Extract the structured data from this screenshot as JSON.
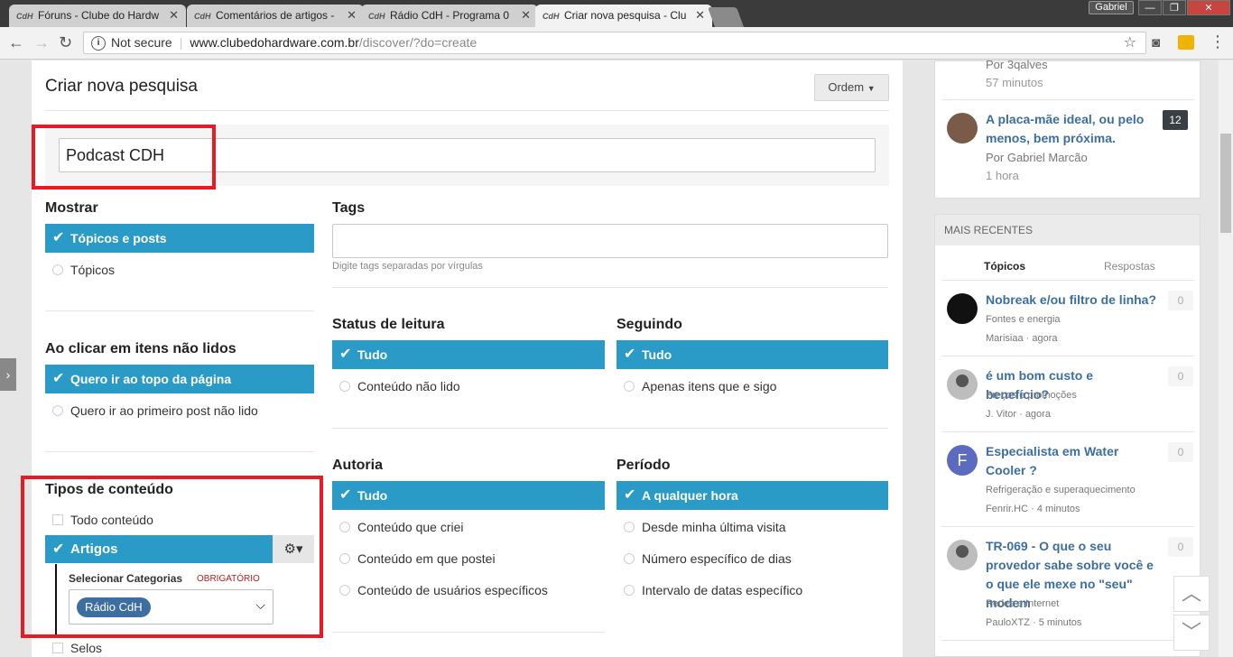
{
  "browser": {
    "tabs": [
      {
        "label": "Fóruns - Clube do Hardw",
        "icon": "cdh-favicon"
      },
      {
        "label": "Comentários de artigos -",
        "icon": "cdh-favicon"
      },
      {
        "label": "Rádio CdH - Programa 0",
        "icon": "cdh-favicon"
      },
      {
        "label": "Criar nova pesquisa - Clu",
        "icon": "cdh-favicon"
      }
    ],
    "favicon_text": "CdH",
    "profile": "Gabriel",
    "security": "Not secure",
    "url_host": "www.clubedohardware.com.br",
    "url_path": "/discover/?do=create"
  },
  "page": {
    "title": "Criar nova pesquisa",
    "order_button": "Ordem",
    "search_value": "Podcast CDH",
    "show": {
      "title": "Mostrar",
      "selected": "Tópicos e posts",
      "option": "Tópicos"
    },
    "tags": {
      "title": "Tags",
      "hint": "Digite tags separadas por vírgulas"
    },
    "click": {
      "title": "Ao clicar em itens não lidos",
      "selected": "Quero ir ao topo da página",
      "option": "Quero ir ao primeiro post não lido"
    },
    "read_status": {
      "title": "Status de leitura",
      "selected": "Tudo",
      "option": "Conteúdo não lido"
    },
    "following": {
      "title": "Seguindo",
      "selected": "Tudo",
      "option": "Apenas itens que e sigo"
    },
    "content_types": {
      "title": "Tipos de conteúdo",
      "all": "Todo conteúdo",
      "selected": "Artigos",
      "categories_label": "Selecionar Categorias",
      "required": "OBRIGATÓRIO",
      "category_token": "Rádio CdH",
      "next": "Selos"
    },
    "author": {
      "title": "Autoria",
      "selected": "Tudo",
      "options": [
        "Conteúdo que criei",
        "Conteúdo em que postei",
        "Conteúdo de usuários específicos"
      ]
    },
    "period": {
      "title": "Período",
      "selected": "A qualquer hora",
      "options": [
        "Desde minha última visita",
        "Número específico de dias",
        "Intervalo de datas específico"
      ]
    }
  },
  "sidebar": {
    "top_items": [
      {
        "by": "Por 3qalves",
        "time": "57 minutos"
      },
      {
        "title": "A placa-mãe ideal, ou pelo menos, bem próxima.",
        "by": "Por Gabriel Marcão",
        "time": "1 hora",
        "count": "12"
      }
    ],
    "recent_header": "MAIS RECENTES",
    "tabs": [
      "Tópicos",
      "Respostas"
    ],
    "recent": [
      {
        "title": "Nobreak e/ou filtro de linha?",
        "forum": "Fontes e energia",
        "author": "Marisiaa",
        "time": "agora",
        "count": "0"
      },
      {
        "title": "é um bom custo e benefício?",
        "forum": "Preços e promoções",
        "author": "J. Vitor",
        "time": "agora",
        "count": "0"
      },
      {
        "title": "Especialista em Water Cooler ?",
        "forum": "Refrigeração e superaquecimento",
        "author": "Fenrir.HC",
        "time": "4 minutos",
        "count": "0",
        "initial": "F"
      },
      {
        "title": "TR-069 - O que o seu provedor sabe sobre você e o que ele mexe no \"seu\" modem",
        "forum": "Redes e Internet",
        "author": "PauloXTZ",
        "time": "5 minutos",
        "count": "0"
      }
    ]
  },
  "colors": {
    "accent": "#2a9ac7",
    "link": "#3c6ea0",
    "highlight": "#e51c23"
  }
}
